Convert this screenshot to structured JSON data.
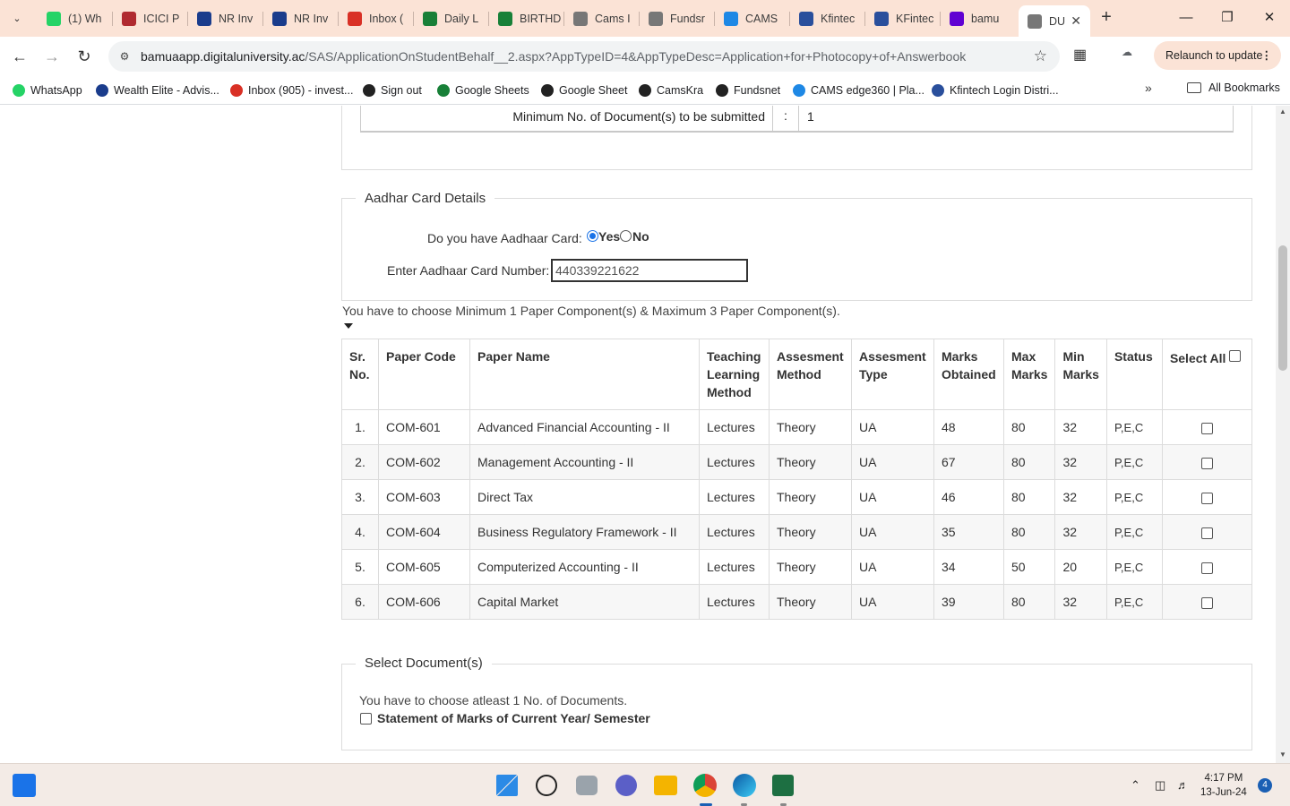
{
  "browser": {
    "tabs": [
      {
        "label": "(1) Wh",
        "icon": "whatsapp-icon",
        "color": "#25d366"
      },
      {
        "label": "ICICI P",
        "icon": "icici-icon",
        "color": "#b02a30"
      },
      {
        "label": "NR Inv",
        "icon": "wealth-elite-icon",
        "color": "#1a3c8c"
      },
      {
        "label": "NR Inv",
        "icon": "wealth-elite-icon",
        "color": "#1a3c8c"
      },
      {
        "label": "Inbox (",
        "icon": "gmail-icon",
        "color": "#d93025"
      },
      {
        "label": "Daily L",
        "icon": "sheets-icon",
        "color": "#188038"
      },
      {
        "label": "BIRTHD",
        "icon": "sheets-icon",
        "color": "#188038"
      },
      {
        "label": "Cams I",
        "icon": "globe-icon",
        "color": "#777777"
      },
      {
        "label": "Fundsr",
        "icon": "globe-icon",
        "color": "#777777"
      },
      {
        "label": "CAMS",
        "icon": "cams-icon",
        "color": "#1e88e5"
      },
      {
        "label": "Kfintec",
        "icon": "kfintech-icon",
        "color": "#2a4f9c"
      },
      {
        "label": "KFintec",
        "icon": "kfintech-icon",
        "color": "#2a4f9c"
      },
      {
        "label": "bamu",
        "icon": "yahoo-icon",
        "color": "#6001d2"
      },
      {
        "label": "DU",
        "icon": "globe-icon",
        "color": "#777777",
        "active": true
      }
    ],
    "url_host": "bamuaapp.digitaluniversity.ac",
    "url_path": "/SAS/ApplicationOnStudentBehalf__2.aspx?AppTypeID=4&AppTypeDesc=Application+for+Photocopy+of+Answerbook",
    "relaunch_label": "Relaunch to update",
    "bookmarks": [
      {
        "label": "WhatsApp",
        "icon": "whatsapp-icon",
        "color": "#25d366"
      },
      {
        "label": "Wealth Elite - Advis...",
        "icon": "wealth-elite-icon",
        "color": "#1a3c8c"
      },
      {
        "label": "Inbox (905) - invest...",
        "icon": "gmail-icon",
        "color": "#d93025"
      },
      {
        "label": "Sign out",
        "icon": "globe-icon",
        "color": "#222222"
      },
      {
        "label": "Google Sheets",
        "icon": "sheets-icon",
        "color": "#188038"
      },
      {
        "label": "Google Sheet",
        "icon": "globe-icon",
        "color": "#222222"
      },
      {
        "label": "CamsKra",
        "icon": "globe-icon",
        "color": "#222222"
      },
      {
        "label": "Fundsnet",
        "icon": "globe-icon",
        "color": "#222222"
      },
      {
        "label": "CAMS edge360 | Pla...",
        "icon": "cams-icon",
        "color": "#1e88e5"
      },
      {
        "label": "Kfintech Login Distri...",
        "icon": "kfintech-icon",
        "color": "#2a4f9c"
      }
    ],
    "all_bookmarks_label": "All Bookmarks"
  },
  "page": {
    "min_docs": {
      "label": "Minimum No. of Document(s) to be submitted",
      "colon": ":",
      "value": "1"
    },
    "aadhar": {
      "legend": "Aadhar Card Details",
      "question": "Do you have Aadhaar Card:",
      "yes_label": "Yes",
      "no_label": "No",
      "selected": "Yes",
      "number_label": "Enter Aadhaar Card Number:",
      "number_value": "440339221622"
    },
    "choose_note": "You have to choose Minimum 1 Paper Component(s) & Maximum 3 Paper Component(s).",
    "table": {
      "headers": [
        "Sr. No.",
        "Paper Code",
        "Paper Name",
        "Teaching Learning Method",
        "Assesment Method",
        "Assesment Type",
        "Marks Obtained",
        "Max Marks",
        "Min Marks",
        "Status",
        "Select All"
      ],
      "rows": [
        {
          "sr": "1.",
          "code": "COM-601",
          "name": "Advanced Financial Accounting - II",
          "teaching": "Lectures",
          "method": "Theory",
          "type": "UA",
          "obtained": "48",
          "max": "80",
          "min": "32",
          "status": "P,E,C"
        },
        {
          "sr": "2.",
          "code": "COM-602",
          "name": "Management Accounting - II",
          "teaching": "Lectures",
          "method": "Theory",
          "type": "UA",
          "obtained": "67",
          "max": "80",
          "min": "32",
          "status": "P,E,C"
        },
        {
          "sr": "3.",
          "code": "COM-603",
          "name": "Direct Tax",
          "teaching": "Lectures",
          "method": "Theory",
          "type": "UA",
          "obtained": "46",
          "max": "80",
          "min": "32",
          "status": "P,E,C"
        },
        {
          "sr": "4.",
          "code": "COM-604",
          "name": "Business Regulatory Framework - II",
          "teaching": "Lectures",
          "method": "Theory",
          "type": "UA",
          "obtained": "35",
          "max": "80",
          "min": "32",
          "status": "P,E,C"
        },
        {
          "sr": "5.",
          "code": "COM-605",
          "name": "Computerized Accounting - II",
          "teaching": "Lectures",
          "method": "Theory",
          "type": "UA",
          "obtained": "34",
          "max": "50",
          "min": "20",
          "status": "P,E,C"
        },
        {
          "sr": "6.",
          "code": "COM-606",
          "name": "Capital Market",
          "teaching": "Lectures",
          "method": "Theory",
          "type": "UA",
          "obtained": "39",
          "max": "80",
          "min": "32",
          "status": "P,E,C"
        }
      ]
    },
    "documents": {
      "legend": "Select Document(s)",
      "note": "You have to choose atleast 1 No. of Documents.",
      "item": "Statement of Marks of Current Year/ Semester"
    }
  },
  "taskbar": {
    "time": "4:17 PM",
    "date": "13-Jun-24",
    "notification_count": "4"
  }
}
